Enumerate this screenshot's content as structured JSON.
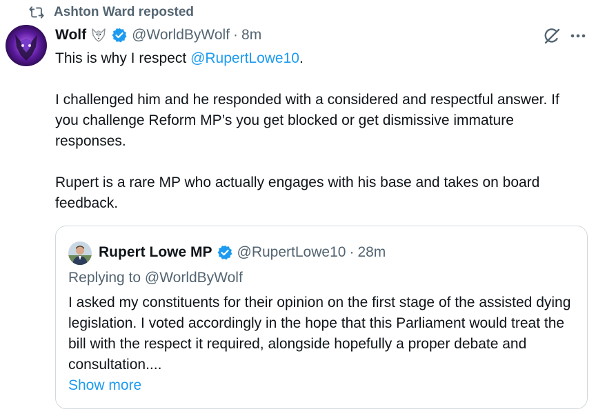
{
  "repost": {
    "text": "Ashton Ward reposted",
    "icon": "repost-icon"
  },
  "tweet": {
    "author_name": "Wolf",
    "author_emoji": "wolf-emoji",
    "verified_icon": "verified-badge-icon",
    "handle": "@WorldByWolf",
    "separator": "·",
    "time": "8m",
    "line1_prefix": "This is why I respect ",
    "line1_mention": "@RupertLowe10",
    "line1_suffix": ".",
    "paragraph2": "I challenged him and he responded with a considered and respectful answer. If you challenge Reform MP’s you get blocked or get dismissive immature responses.",
    "paragraph3": "Rupert is a rare MP who actually engages with his base and takes on board feedback."
  },
  "quote": {
    "author_name": "Rupert Lowe MP",
    "verified_icon": "verified-badge-icon",
    "handle": "@RupertLowe10",
    "separator": "·",
    "time": "28m",
    "reply_to": "Replying to @WorldByWolf",
    "body": "I asked my constituents for their opinion on the first stage of the assisted dying legislation. I voted accordingly in the hope that this Parliament would treat the bill with the respect it required, alongside hopefully a proper debate and consultation....",
    "show_more": "Show more"
  },
  "colors": {
    "text": "#0f1419",
    "secondary": "#536471",
    "link": "#1d9bf0",
    "verified": "#1d9bf0",
    "border": "#cfd9de"
  }
}
